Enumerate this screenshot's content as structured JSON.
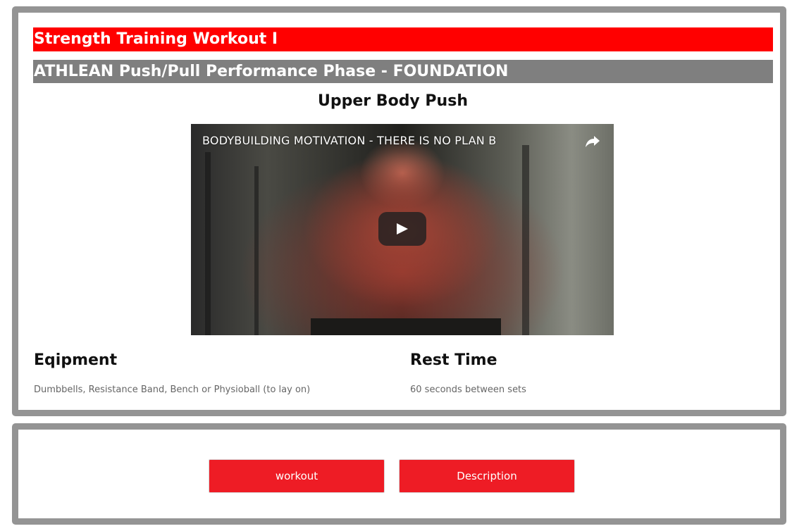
{
  "header": {
    "workout_title": "Strength Training Workout I",
    "program_title": "ATHLEAN Push/Pull Performance Phase - FOUNDATION"
  },
  "section": {
    "title": "Upper Body Push"
  },
  "video": {
    "title": "BODYBUILDING MOTIVATION - THERE IS NO PLAN B",
    "share_icon": "share-arrow-icon",
    "play_icon": "play-icon"
  },
  "equipment": {
    "heading": "Eqipment",
    "text": "Dumbbells, Resistance Band, Bench or Physioball (to lay on)"
  },
  "rest": {
    "heading": "Rest Time",
    "text": "60 seconds between sets"
  },
  "actions": {
    "workout_label": "workout",
    "description_label": "Description"
  },
  "colors": {
    "accent_red": "#ff0000",
    "button_red": "#ee1c25",
    "subtitle_gray": "#7f7f7f",
    "border_gray": "#949494"
  }
}
